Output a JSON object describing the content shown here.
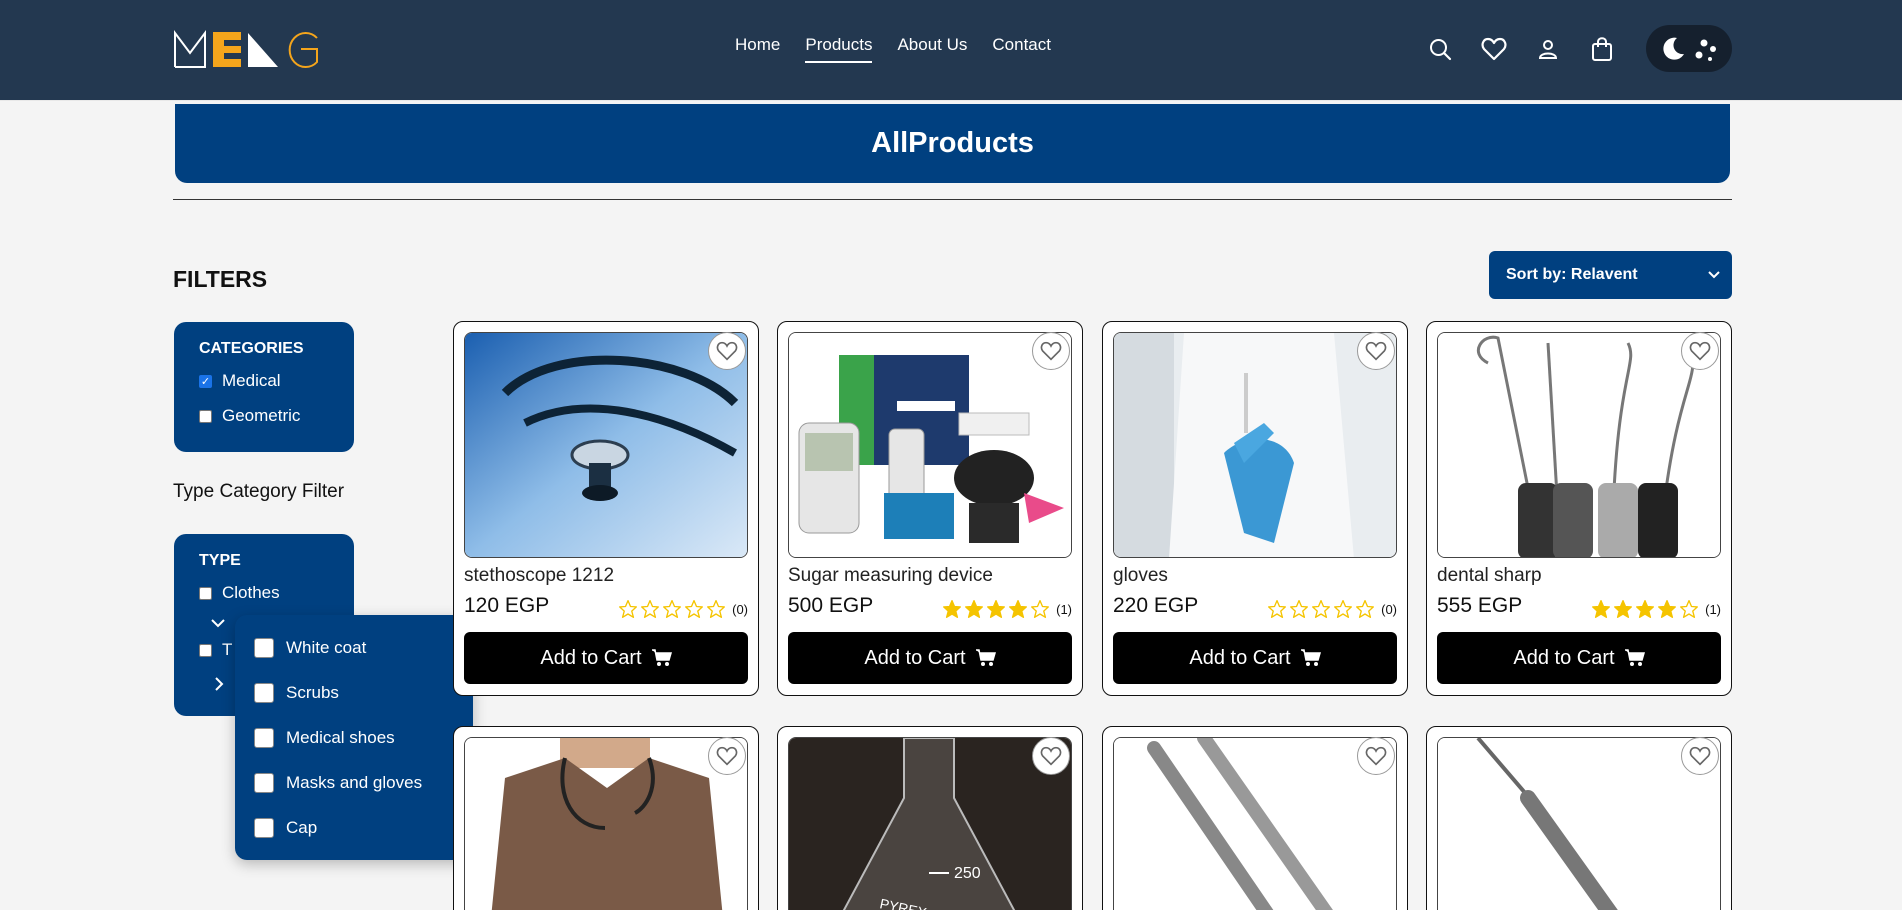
{
  "brand": {
    "logo_text": "MENG"
  },
  "nav": {
    "items": [
      "Home",
      "Products",
      "About Us",
      "Contact"
    ],
    "active": "Products"
  },
  "header_icons": [
    "search-icon",
    "heart-icon",
    "user-icon",
    "shopping-bag-icon"
  ],
  "theme_toggle": {
    "icons": [
      "moon-icon",
      "dots-icon"
    ]
  },
  "banner": {
    "title": "AllProducts"
  },
  "filters": {
    "title": "FILTERS",
    "categories": {
      "heading": "CATEGORIES",
      "items": [
        {
          "label": "Medical",
          "checked": true
        },
        {
          "label": "Geometric",
          "checked": false
        }
      ]
    },
    "type_category_label": "Type Category Filter",
    "type": {
      "heading": "TYPE",
      "items": [
        {
          "label": "Clothes",
          "checked": false
        },
        {
          "label": "T",
          "checked": false
        }
      ]
    },
    "clothes_dropdown": [
      "White coat",
      "Scrubs",
      "Medical shoes",
      "Masks and gloves",
      "Cap"
    ]
  },
  "sort": {
    "label": "Sort by: Relavent"
  },
  "products": [
    {
      "name": "stethoscope 1212",
      "price": "120 EGP",
      "rating": 0,
      "count": "(0)",
      "cart": "Add to Cart"
    },
    {
      "name": "Sugar measuring device",
      "price": "500 EGP",
      "rating": 4,
      "count": "(1)",
      "cart": "Add to Cart"
    },
    {
      "name": "gloves",
      "price": "220 EGP",
      "rating": 0,
      "count": "(0)",
      "cart": "Add to Cart"
    },
    {
      "name": "dental sharp",
      "price": "555 EGP",
      "rating": 4,
      "count": "(1)",
      "cart": "Add to Cart"
    }
  ],
  "colors": {
    "header": "#233850",
    "primary": "#004080",
    "star": "#f5c400",
    "logo_accent": "#f4a51c"
  }
}
